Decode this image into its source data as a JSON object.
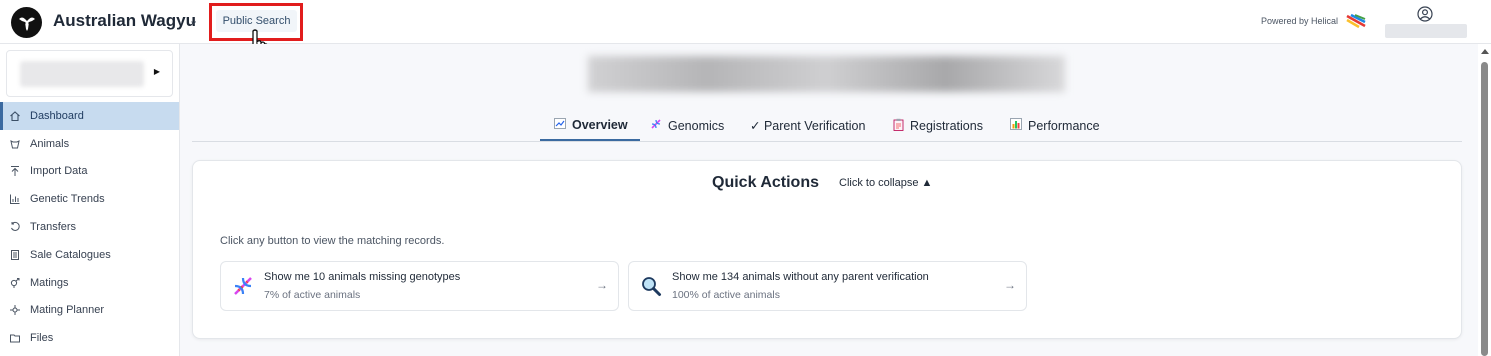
{
  "header": {
    "app_title": "Australian Wagyu",
    "public_search_label": "Public Search",
    "powered_by": "Powered by Helical"
  },
  "sidebar": {
    "items": [
      {
        "label": "Dashboard",
        "icon": "home-icon",
        "active": true
      },
      {
        "label": "Animals",
        "icon": "cow-icon"
      },
      {
        "label": "Import Data",
        "icon": "upload-icon"
      },
      {
        "label": "Genetic Trends",
        "icon": "bar-chart-icon"
      },
      {
        "label": "Transfers",
        "icon": "transfer-icon"
      },
      {
        "label": "Sale Catalogues",
        "icon": "catalogue-icon"
      },
      {
        "label": "Matings",
        "icon": "gender-icon"
      },
      {
        "label": "Mating Planner",
        "icon": "planner-icon"
      },
      {
        "label": "Files",
        "icon": "folder-icon"
      }
    ]
  },
  "main": {
    "tabs": [
      {
        "label": "Overview",
        "icon": "chart-icon",
        "active": true
      },
      {
        "label": "Genomics",
        "icon": "dna-icon"
      },
      {
        "label": "✓ Parent Verification"
      },
      {
        "label": "Registrations",
        "icon": "clipboard-icon"
      },
      {
        "label": "Performance",
        "icon": "bar-chart-icon"
      }
    ],
    "quick_actions": {
      "title": "Quick Actions",
      "collapse_label": "Click to collapse ▲",
      "hint": "Click any button to view the matching records.",
      "actions": [
        {
          "title": "Show me 10 animals missing genotypes",
          "subtitle": "7% of active animals",
          "icon": "dna-icon"
        },
        {
          "title": "Show me 134 animals without any parent verification",
          "subtitle": "100% of active animals",
          "icon": "magnifier-icon"
        }
      ]
    }
  },
  "colors": {
    "accent": "#3b6aa0",
    "active_nav_bg": "#c7dbef",
    "highlight_box": "#e11d1d"
  }
}
